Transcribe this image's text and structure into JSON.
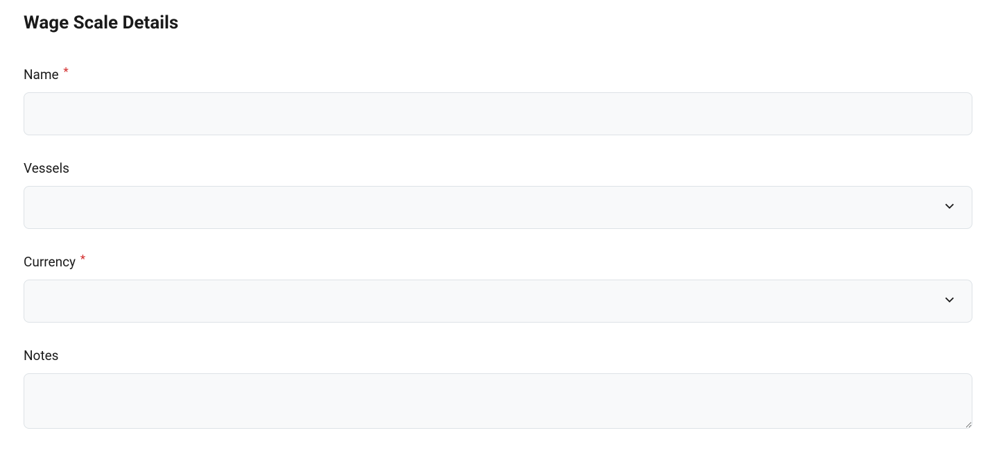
{
  "page": {
    "title": "Wage Scale Details"
  },
  "form": {
    "name": {
      "label": "Name",
      "required": true,
      "value": ""
    },
    "vessels": {
      "label": "Vessels",
      "required": false,
      "value": ""
    },
    "currency": {
      "label": "Currency",
      "required": true,
      "value": ""
    },
    "notes": {
      "label": "Notes",
      "required": false,
      "value": ""
    }
  }
}
